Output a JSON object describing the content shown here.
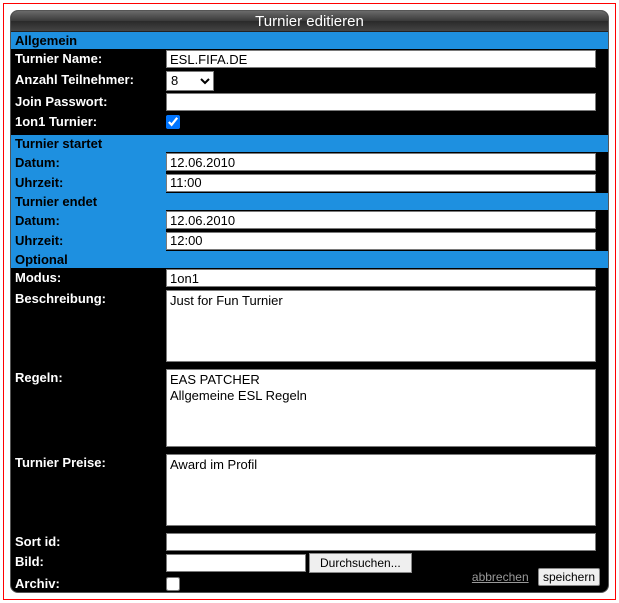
{
  "window": {
    "title": "Turnier editieren"
  },
  "sections": {
    "allgemein": {
      "header": "Allgemein",
      "turnier_name": {
        "label": "Turnier Name:",
        "value": "ESL.FIFA.DE"
      },
      "anzahl_teilnehmer": {
        "label": "Anzahl Teilnehmer:",
        "value": "8"
      },
      "join_passwort": {
        "label": "Join Passwort:",
        "value": ""
      },
      "one_on_one": {
        "label": "1on1 Turnier:",
        "checked": true
      }
    },
    "startet": {
      "header": "Turnier startet",
      "datum": {
        "label": "Datum:",
        "value": "12.06.2010"
      },
      "uhrzeit": {
        "label": "Uhrzeit:",
        "value": "11:00"
      }
    },
    "endet": {
      "header": "Turnier endet",
      "datum": {
        "label": "Datum:",
        "value": "12.06.2010"
      },
      "uhrzeit": {
        "label": "Uhrzeit:",
        "value": "12:00"
      }
    },
    "optional": {
      "header": "Optional",
      "modus": {
        "label": "Modus:",
        "value": "1on1"
      },
      "beschreibung": {
        "label": "Beschreibung:",
        "value": "Just for Fun Turnier"
      },
      "regeln": {
        "label": "Regeln:",
        "value": "EAS PATCHER\nAllgemeine ESL Regeln"
      },
      "preise": {
        "label": "Turnier Preise:",
        "value": "Award im Profil"
      },
      "sort_id": {
        "label": "Sort id:",
        "value": ""
      },
      "bild": {
        "label": "Bild:",
        "value": "",
        "browse": "Durchsuchen..."
      },
      "archiv": {
        "label": "Archiv:",
        "checked": false
      }
    }
  },
  "footer": {
    "cancel": "abbrechen",
    "save": "speichern"
  }
}
